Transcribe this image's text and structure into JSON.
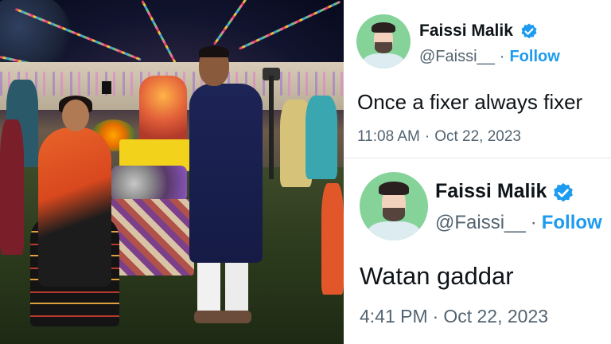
{
  "photo": {
    "description_icon": "festival-photo"
  },
  "tweets": [
    {
      "name": "Faissi Malik",
      "handle": "@Faissi__",
      "separator": "·",
      "follow_label": "Follow",
      "text": "Once a fixer always fixer",
      "time": "11:08 AM",
      "date": "Oct 22, 2023",
      "verified_icon": "verified-badge-icon"
    },
    {
      "name": "Faissi Malik",
      "handle": "@Faissi__",
      "separator": "·",
      "follow_label": "Follow",
      "text": "Watan gaddar",
      "time": "4:41 PM",
      "date": "Oct 22, 2023",
      "verified_icon": "verified-badge-icon"
    }
  ],
  "colors": {
    "accent": "#1d9bf0",
    "text": "#0f1419",
    "muted": "#536471",
    "avatar_bg": "#86d39a"
  }
}
